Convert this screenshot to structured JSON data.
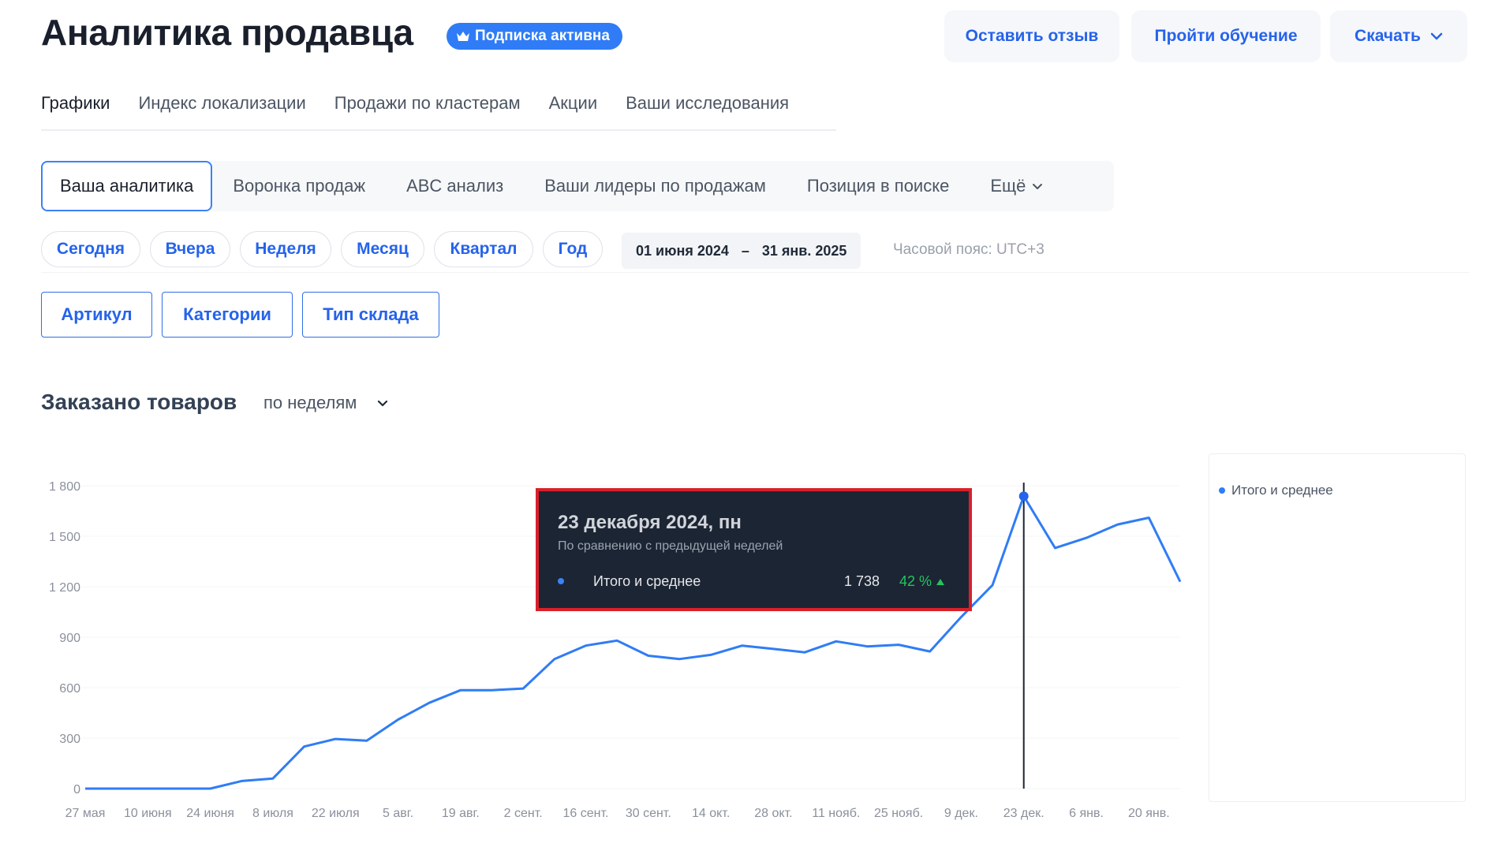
{
  "header": {
    "title": "Аналитика продавца",
    "badge": "Подписка активна",
    "buttons": {
      "review": "Оставить отзыв",
      "learn": "Пройти обучение",
      "download": "Скачать"
    }
  },
  "top_tabs": [
    {
      "label": "Графики",
      "active": true
    },
    {
      "label": "Индекс локализации"
    },
    {
      "label": "Продажи по кластерам"
    },
    {
      "label": "Акции"
    },
    {
      "label": "Ваши исследования"
    }
  ],
  "sub_tabs": [
    {
      "label": "Ваша аналитика",
      "active": true
    },
    {
      "label": "Воронка продаж"
    },
    {
      "label": "ABC анализ"
    },
    {
      "label": "Ваши лидеры по продажам"
    },
    {
      "label": "Позиция в поиске"
    },
    {
      "label": "Ещё"
    }
  ],
  "periods": [
    "Сегодня",
    "Вчера",
    "Неделя",
    "Месяц",
    "Квартал",
    "Год"
  ],
  "date_range": {
    "from": "01 июня 2024",
    "sep": "–",
    "to": "31 янв. 2025"
  },
  "timezone": "Часовой пояс: UTC+3",
  "filters": [
    "Артикул",
    "Категории",
    "Тип склада"
  ],
  "chart_section": {
    "title": "Заказано товаров",
    "granularity": "по неделям"
  },
  "tooltip": {
    "title": "23 декабря 2024, пн",
    "subtitle": "По сравнению с предыдущей неделей",
    "series": "Итого и среднее",
    "value": "1 738",
    "change": "42 %"
  },
  "colors": {
    "accent": "#2f7cf6",
    "link": "#2563eb",
    "positive": "#22c55e",
    "tooltip_bg": "#1c2533",
    "highlight": "#d9202a"
  },
  "chart_data": {
    "type": "line",
    "ylim": [
      0,
      1800
    ],
    "y_ticks": [
      "1 800",
      "1 500",
      "1 200",
      "900",
      "600",
      "300",
      "0"
    ],
    "y_tick_values": [
      1800,
      1500,
      1200,
      900,
      600,
      300,
      0
    ],
    "x_labels": [
      "27 мая",
      "10 июня",
      "24 июня",
      "8 июля",
      "22 июля",
      "5 авг.",
      "19 авг.",
      "2 сент.",
      "16 сент.",
      "30 сент.",
      "14 окт.",
      "28 окт.",
      "11 нояб.",
      "25 нояб.",
      "9 дек.",
      "23 дек.",
      "6 янв.",
      "20 янв."
    ],
    "series": [
      {
        "name": "Итого и среднее",
        "values": [
          0,
          0,
          0,
          0,
          0,
          45,
          60,
          250,
          295,
          285,
          410,
          510,
          585,
          585,
          595,
          770,
          850,
          880,
          790,
          770,
          795,
          850,
          830,
          810,
          875,
          845,
          855,
          815,
          1020,
          1210,
          1738,
          1430,
          1490,
          1570,
          1610,
          1230
        ]
      }
    ],
    "highlight_index": 30,
    "legend": "top-right",
    "grid": true
  }
}
